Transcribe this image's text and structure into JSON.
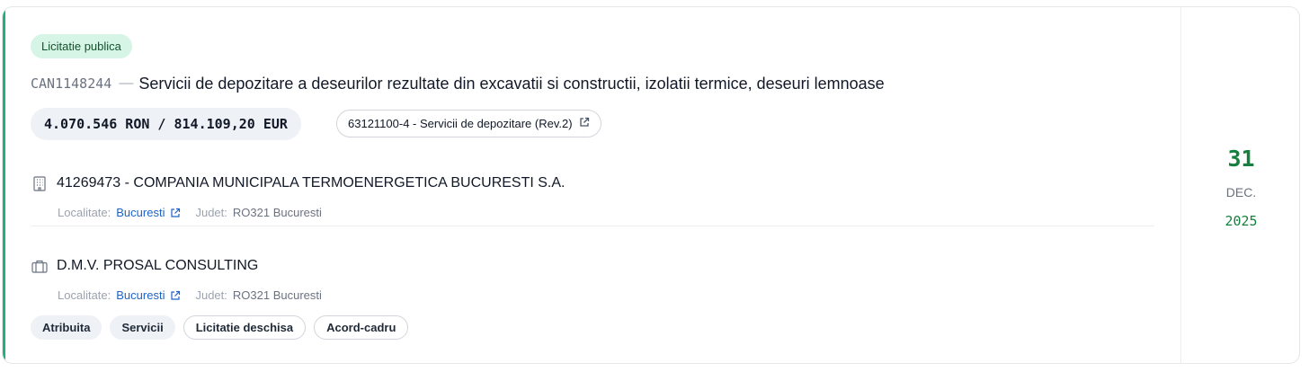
{
  "notice": {
    "type_badge": "Licitatie publica",
    "code": "CAN1148244",
    "separator": "—",
    "title": "Servicii de depozitare a deseurilor rezultate din excavatii si constructii, izolatii termice, deseuri lemnoase",
    "value": "4.070.546 RON / 814.109,20 EUR",
    "cpv": "63121100-4 - Servicii de depozitare (Rev.2)"
  },
  "authority": {
    "name": "41269473 - COMPANIA MUNICIPALA TERMOENERGETICA BUCURESTI S.A.",
    "locality_label": "Localitate:",
    "locality": "Bucuresti",
    "county_label": "Judet:",
    "county": "RO321 Bucuresti",
    "icon": "building-icon"
  },
  "supplier": {
    "name": "D.M.V. PROSAL CONSULTING",
    "locality_label": "Localitate:",
    "locality": "Bucuresti",
    "county_label": "Judet:",
    "county": "RO321 Bucuresti",
    "icon": "briefcase-icon"
  },
  "tags": [
    {
      "label": "Atribuita"
    },
    {
      "label": "Servicii"
    },
    {
      "label": "Licitatie deschisa"
    },
    {
      "label": "Acord-cadru"
    }
  ],
  "date": {
    "day": "31",
    "month": "DEC.",
    "year": "2025"
  },
  "colors": {
    "accent": "#22b07d",
    "badge_bg": "#d6f5e6",
    "link": "#1d63c7",
    "date_green": "#15803d"
  }
}
